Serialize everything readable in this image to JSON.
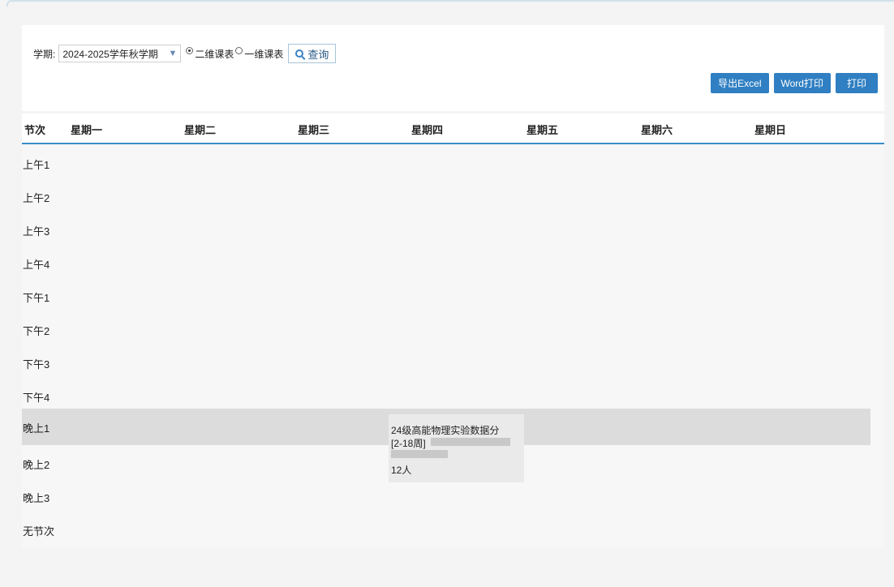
{
  "toolbar": {
    "term_label": "学期:",
    "term_value": "2024-2025学年秋学期",
    "radio_2d_label": "二维课表",
    "radio_1d_label": "一维课表",
    "query_label": "查询",
    "export_excel": "导出Excel",
    "word_print": "Word打印",
    "print": "打印"
  },
  "table": {
    "headers": [
      "节次",
      "星期一",
      "星期二",
      "星期三",
      "星期四",
      "星期五",
      "星期六",
      "星期日"
    ],
    "rows": [
      "上午1",
      "上午2",
      "上午3",
      "上午4",
      "下午1",
      "下午2",
      "下午3",
      "下午4",
      "晚上1",
      "晚上2",
      "晚上3",
      "无节次"
    ],
    "course": {
      "name": "24级高能物理实验数据分",
      "weeks": "[2-18周]",
      "count": "12人"
    }
  }
}
